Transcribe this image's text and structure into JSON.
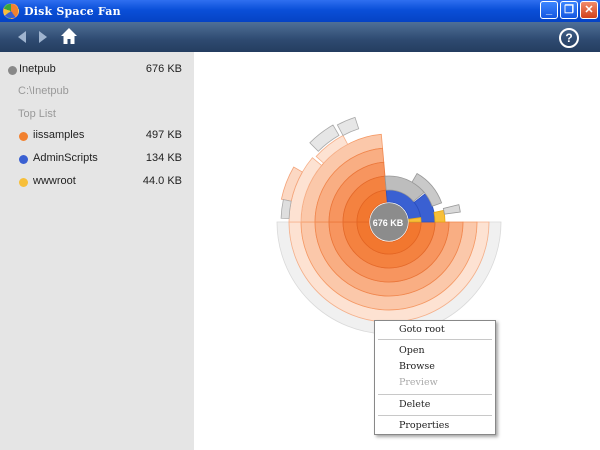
{
  "window": {
    "title": "Disk Space Fan"
  },
  "titlebar_buttons": [
    "_",
    "❐",
    "✕"
  ],
  "toolbar": {
    "help_label": "?"
  },
  "sidebar": {
    "root": {
      "name": "Inetpub",
      "size": "676 KB"
    },
    "path": "C:\\Inetpub",
    "top_list_label": "Top List",
    "items": [
      {
        "name": "iissamples",
        "size": "497 KB",
        "color": "#f2812f"
      },
      {
        "name": "AdminScripts",
        "size": "134 KB",
        "color": "#3a60d2"
      },
      {
        "name": "wwwroot",
        "size": "44.0 KB",
        "color": "#f7bf3a"
      }
    ]
  },
  "chart": {
    "center_label": "676 KB"
  },
  "context_menu": {
    "items": [
      {
        "label": "Goto root",
        "enabled": true
      },
      {
        "label": "Open",
        "enabled": true
      },
      {
        "label": "Browse",
        "enabled": true
      },
      {
        "label": "Preview",
        "enabled": false
      },
      {
        "label": "Delete",
        "enabled": true
      },
      {
        "label": "Properties",
        "enabled": true
      }
    ]
  }
}
